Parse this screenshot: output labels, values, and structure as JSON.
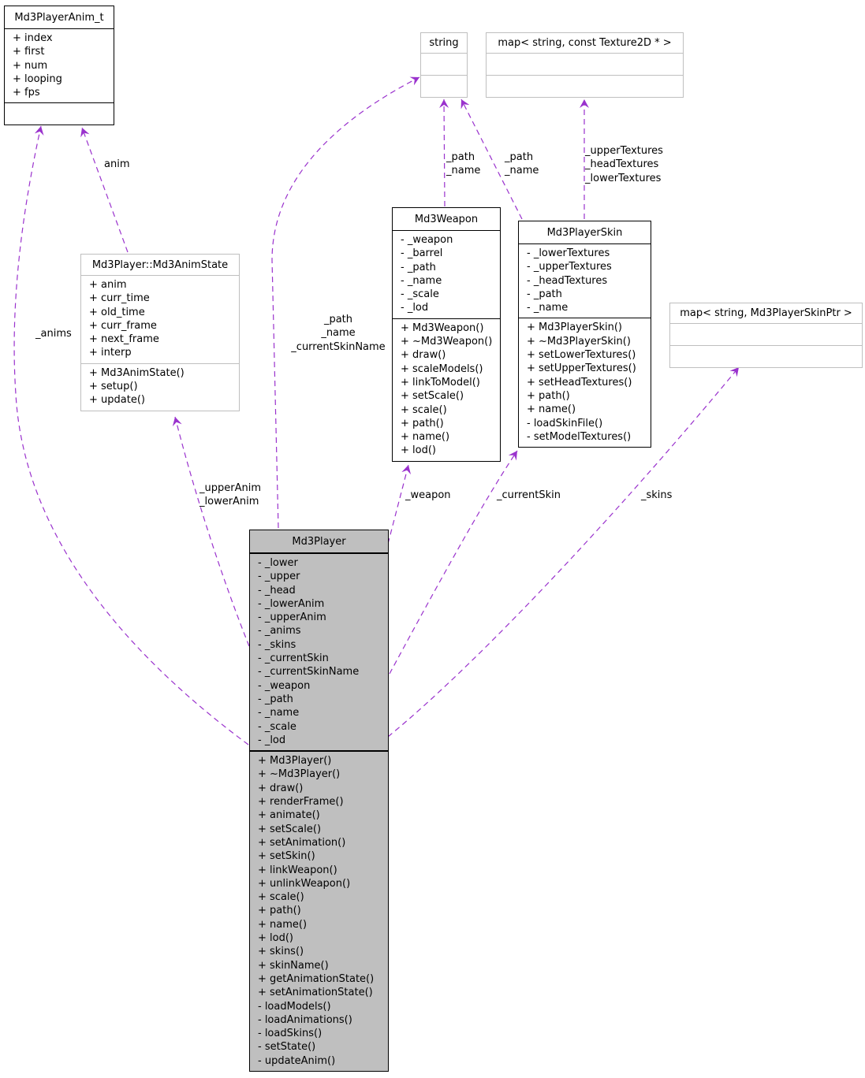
{
  "colors": {
    "edge": "#9a32cd",
    "main_fill": "#bfbfbf",
    "ext_border": "#bfbfbf"
  },
  "classes": {
    "anim_t": {
      "name": "Md3PlayerAnim_t",
      "attributes": [
        "+ index",
        "+ first",
        "+ num",
        "+ looping",
        "+ fps"
      ],
      "methods": []
    },
    "string": {
      "name": "string",
      "attributes": [],
      "methods": []
    },
    "texmap": {
      "name": "map< string, const Texture2D * >",
      "attributes": [],
      "methods": []
    },
    "animstate": {
      "name": "Md3Player::Md3AnimState",
      "attributes": [
        "+ anim",
        "+ curr_time",
        "+ old_time",
        "+ curr_frame",
        "+ next_frame",
        "+ interp"
      ],
      "methods": [
        "+ Md3AnimState()",
        "+ setup()",
        "+ update()"
      ]
    },
    "weapon": {
      "name": "Md3Weapon",
      "attributes": [
        "- _weapon",
        "- _barrel",
        "- _path",
        "- _name",
        "- _scale",
        "- _lod"
      ],
      "methods": [
        "+ Md3Weapon()",
        "+ ~Md3Weapon()",
        "+ draw()",
        "+ scaleModels()",
        "+ linkToModel()",
        "+ setScale()",
        "+ scale()",
        "+ path()",
        "+ name()",
        "+ lod()"
      ]
    },
    "skin": {
      "name": "Md3PlayerSkin",
      "attributes": [
        "- _lowerTextures",
        "- _upperTextures",
        "- _headTextures",
        "- _path",
        "- _name"
      ],
      "methods": [
        "+ Md3PlayerSkin()",
        "+ ~Md3PlayerSkin()",
        "+ setLowerTextures()",
        "+ setUpperTextures()",
        "+ setHeadTextures()",
        "+ path()",
        "+ name()",
        "- loadSkinFile()",
        "- setModelTextures()"
      ]
    },
    "skinmap": {
      "name": "map< string, Md3PlayerSkinPtr >",
      "attributes": [],
      "methods": []
    },
    "player": {
      "name": "Md3Player",
      "attributes": [
        "- _lower",
        "- _upper",
        "- _head",
        "- _lowerAnim",
        "- _upperAnim",
        "- _anims",
        "- _skins",
        "- _currentSkin",
        "- _currentSkinName",
        "- _weapon",
        "- _path",
        "- _name",
        "- _scale",
        "- _lod"
      ],
      "methods": [
        "+ Md3Player()",
        "+ ~Md3Player()",
        "+ draw()",
        "+ renderFrame()",
        "+ animate()",
        "+ setScale()",
        "+ setAnimation()",
        "+ setSkin()",
        "+ linkWeapon()",
        "+ unlinkWeapon()",
        "+ scale()",
        "+ path()",
        "+ name()",
        "+ lod()",
        "+ skins()",
        "+ skinName()",
        "+ getAnimationState()",
        "+ setAnimationState()",
        "- loadModels()",
        "- loadAnimations()",
        "- loadSkins()",
        "- setState()",
        "- updateAnim()"
      ]
    }
  },
  "edges": [
    {
      "id": "anims",
      "from": "player",
      "to": "anim_t",
      "labels": [
        "_anims"
      ]
    },
    {
      "id": "anim",
      "from": "animstate",
      "to": "anim_t",
      "labels": [
        "anim"
      ]
    },
    {
      "id": "player-string",
      "from": "player",
      "to": "string",
      "labels": [
        "_path",
        "_name",
        "_currentSkinName"
      ]
    },
    {
      "id": "weapon-string",
      "from": "weapon",
      "to": "string",
      "labels": [
        "_path",
        "_name"
      ]
    },
    {
      "id": "skin-string",
      "from": "skin",
      "to": "string",
      "labels": [
        "_path",
        "_name"
      ]
    },
    {
      "id": "skin-texmap",
      "from": "skin",
      "to": "texmap",
      "labels": [
        "_upperTextures",
        "_headTextures",
        "_lowerTextures"
      ]
    },
    {
      "id": "animstate",
      "from": "player",
      "to": "animstate",
      "labels": [
        "_upperAnim",
        "_lowerAnim"
      ]
    },
    {
      "id": "weapon",
      "from": "player",
      "to": "weapon",
      "labels": [
        "_weapon"
      ]
    },
    {
      "id": "currentSkin",
      "from": "player",
      "to": "skin",
      "labels": [
        "_currentSkin"
      ]
    },
    {
      "id": "skins",
      "from": "player",
      "to": "skinmap",
      "labels": [
        "_skins"
      ]
    }
  ]
}
